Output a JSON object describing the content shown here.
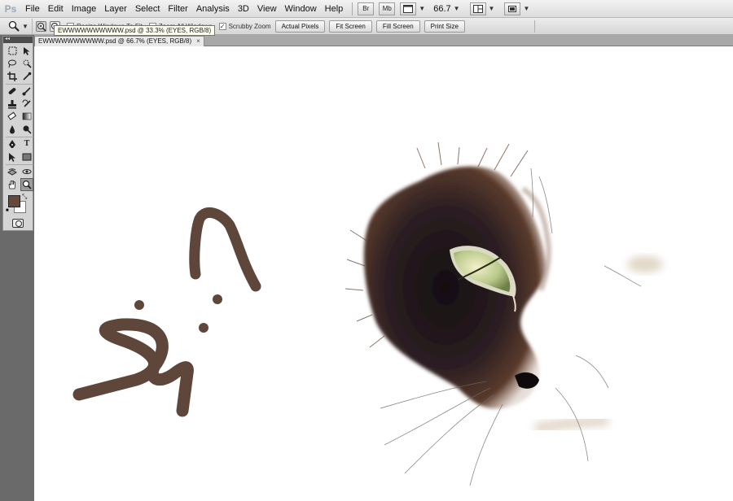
{
  "app": {
    "logo": "Ps"
  },
  "menu": [
    "File",
    "Edit",
    "Image",
    "Layer",
    "Select",
    "Filter",
    "Analysis",
    "3D",
    "View",
    "Window",
    "Help"
  ],
  "appbar": {
    "bridge": "Br",
    "minibridge": "Mb",
    "zoom_level": "66.7"
  },
  "options": {
    "resize_windows": "Resize Windows To Fit",
    "zoom_all": "Zoom All Windows",
    "scrubby": "Scrubby Zoom",
    "actual_pixels": "Actual Pixels",
    "fit_screen": "Fit Screen",
    "fill_screen": "Fill Screen",
    "print_size": "Print Size"
  },
  "tooltip": "EWWWWWWWWWW.psd @ 33.3% (EYES, RGB/8)",
  "document": {
    "tab_title": "EWWWWWWWWWW.psd @ 66.7% (EYES, RGB/8)",
    "close": "×"
  },
  "colors": {
    "foreground": "#66483a",
    "background": "#ffffff",
    "stroke": "#5e463a"
  },
  "tools": [
    "marquee-tool",
    "move-tool",
    "lasso-tool",
    "quick-selection-tool",
    "crop-tool",
    "eyedropper-tool",
    "healing-brush-tool",
    "brush-tool",
    "clone-stamp-tool",
    "history-brush-tool",
    "eraser-tool",
    "gradient-tool",
    "blur-tool",
    "dodge-tool",
    "pen-tool",
    "type-tool",
    "path-selection-tool",
    "rectangle-tool",
    "3d-rotate-tool",
    "3d-orbit-tool",
    "hand-tool",
    "zoom-tool"
  ],
  "tool_glyphs": {
    "type-tool": "T"
  }
}
